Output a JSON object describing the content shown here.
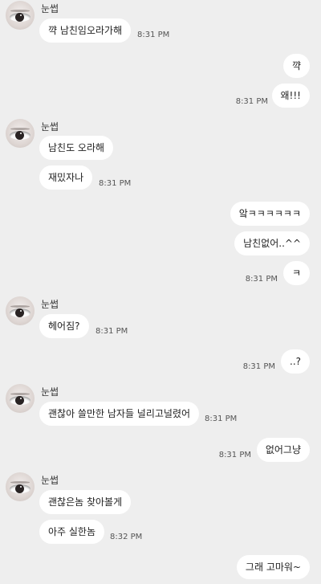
{
  "chat": {
    "sender_name": "눈썹",
    "messages": [
      {
        "from": "them",
        "text": "꺅 남친임오라가해",
        "time": "8:31 PM"
      },
      {
        "from": "me",
        "text": "꺅"
      },
      {
        "from": "me",
        "text": "왜!!!",
        "time": "8:31 PM"
      },
      {
        "from": "them",
        "text": "남친도 오라해"
      },
      {
        "from": "them",
        "text": "재밌자나",
        "time": "8:31 PM"
      },
      {
        "from": "me",
        "text": "앜ㅋㅋㅋㅋㅋㅋ"
      },
      {
        "from": "me",
        "text": "남친없어..^^"
      },
      {
        "from": "me",
        "text": "ㅋ",
        "time": "8:31 PM"
      },
      {
        "from": "them",
        "text": "헤어짐?",
        "time": "8:31 PM"
      },
      {
        "from": "me",
        "text": "..?",
        "time": "8:31 PM"
      },
      {
        "from": "them",
        "text": "괜찮아 쓸만한 남자들 널리고널렸어",
        "time": "8:31 PM"
      },
      {
        "from": "me",
        "text": "없어그냥",
        "time": "8:31 PM"
      },
      {
        "from": "them",
        "text": "괜찮은놈 찾아볼게"
      },
      {
        "from": "them",
        "text": "아주 실한놈",
        "time": "8:32 PM"
      },
      {
        "from": "me",
        "text": "그래 고마워~"
      }
    ]
  }
}
